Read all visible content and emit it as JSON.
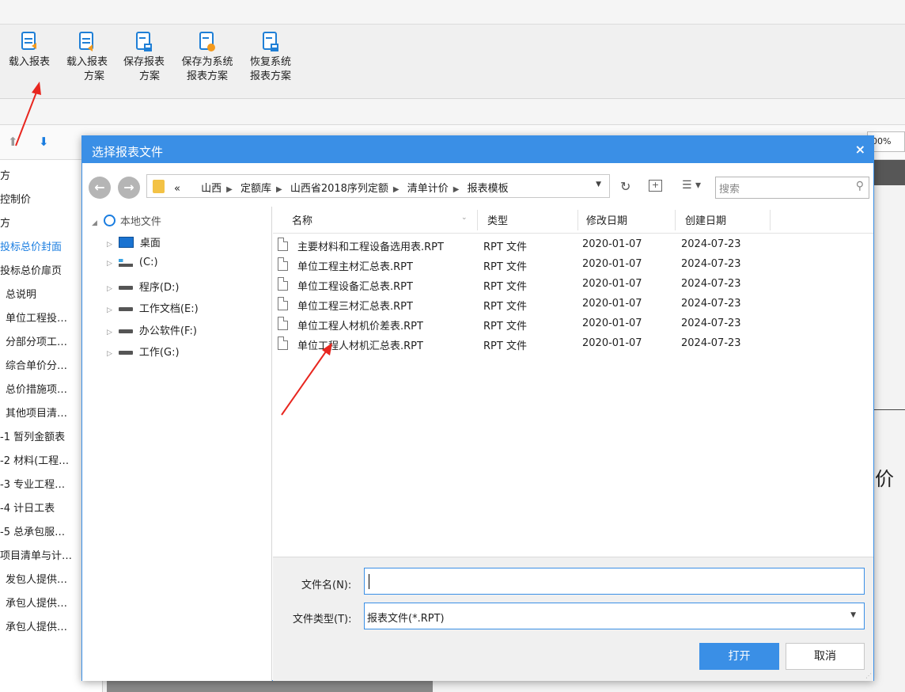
{
  "ribbon": {
    "buttons": [
      {
        "line1": "载入报表",
        "line2": ""
      },
      {
        "line1": "载入报表",
        "line2": "方案"
      },
      {
        "line1": "保存报表",
        "line2": "方案"
      },
      {
        "line1": "保存为系统",
        "line2": "报表方案"
      },
      {
        "line1": "恢复系统",
        "line2": "报表方案"
      }
    ]
  },
  "toolbar2": {
    "up": "⬆",
    "down": "⬇",
    "zoom": "00%"
  },
  "tree": {
    "items": [
      "方",
      "控制价",
      "方",
      "投标总价封面",
      "投标总价扉页",
      "总说明",
      "单位工程投…",
      "分部分项工…",
      "综合单价分…",
      "总价措施项…",
      "其他项目清…",
      "-1 暂列金额表",
      "-2 材料(工程…",
      "-3 专业工程…",
      "-4 计日工表",
      "-5 总承包服…",
      "项目清单与计…",
      "发包人提供…",
      "承包人提供…",
      "承包人提供…"
    ]
  },
  "background": {
    "jia": "价"
  },
  "dialog": {
    "title": "选择报表文件",
    "close": "×",
    "back": "←",
    "forward": "→",
    "breadcrumb": {
      "overflow": "«",
      "parts": [
        "山西",
        "定额库",
        "山西省2018序列定额",
        "清单计价",
        "报表模板"
      ]
    },
    "dropdown": "▼",
    "refresh": "↻",
    "new_folder": "+",
    "view_menu": "☰ ▾",
    "search_placeholder": "搜索",
    "nav": {
      "root": "本地文件",
      "items": [
        "桌面",
        "(C:)",
        "程序(D:)",
        "工作文档(E:)",
        "办公软件(F:)",
        "工作(G:)"
      ]
    },
    "columns": {
      "name": "名称",
      "type": "类型",
      "modified": "修改日期",
      "created": "创建日期"
    },
    "files": [
      {
        "name": "主要材料和工程设备选用表.RPT",
        "type": "RPT 文件",
        "modified": "2020-01-07",
        "created": "2024-07-23"
      },
      {
        "name": "单位工程主材汇总表.RPT",
        "type": "RPT 文件",
        "modified": "2020-01-07",
        "created": "2024-07-23"
      },
      {
        "name": "单位工程设备汇总表.RPT",
        "type": "RPT 文件",
        "modified": "2020-01-07",
        "created": "2024-07-23"
      },
      {
        "name": "单位工程三材汇总表.RPT",
        "type": "RPT 文件",
        "modified": "2020-01-07",
        "created": "2024-07-23"
      },
      {
        "name": "单位工程人材机价差表.RPT",
        "type": "RPT 文件",
        "modified": "2020-01-07",
        "created": "2024-07-23"
      },
      {
        "name": "单位工程人材机汇总表.RPT",
        "type": "RPT 文件",
        "modified": "2020-01-07",
        "created": "2024-07-23"
      }
    ],
    "filename_label": "文件名(N):",
    "filename_value": "",
    "filetype_label": "文件类型(T):",
    "filetype_value": "报表文件(*.RPT)",
    "open_button": "打开",
    "cancel_button": "取消"
  }
}
